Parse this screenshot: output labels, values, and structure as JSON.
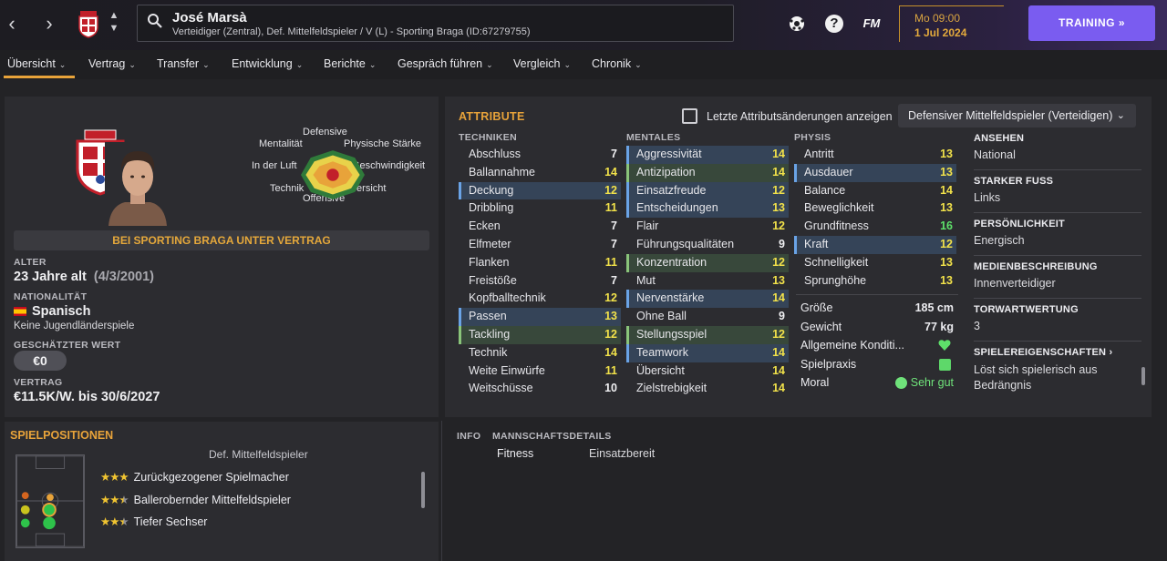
{
  "header": {
    "player_name": "José Marsà",
    "player_subtitle": "Verteidiger (Zentral), Def. Mittelfeldspieler / V (L) - Sporting Braga (ID:67279755)",
    "date_time": "Mo 09:00",
    "date_day": "1 Jul 2024",
    "training_label": "TRAINING »",
    "fm_label": "FM",
    "help_label": "?"
  },
  "tabs": [
    {
      "label": "Übersicht"
    },
    {
      "label": "Vertrag"
    },
    {
      "label": "Transfer"
    },
    {
      "label": "Entwicklung"
    },
    {
      "label": "Berichte"
    },
    {
      "label": "Gespräch führen"
    },
    {
      "label": "Vergleich"
    },
    {
      "label": "Chronik"
    }
  ],
  "profile": {
    "radar_labels": {
      "top": "Defensive",
      "top_left": "Mentalität",
      "top_right": "Physische Stärke",
      "left": "In der Luft",
      "right": "Geschwindigkeit",
      "bottom_left": "Technik",
      "bottom_right": "Übersicht",
      "bottom": "Offensive"
    },
    "contract_banner": "BEI SPORTING BRAGA UNTER VERTRAG",
    "age_label": "ALTER",
    "age_value": "23 Jahre alt",
    "age_dob": "(4/3/2001)",
    "nationality_label": "NATIONALITÄT",
    "nationality_value": "Spanisch",
    "nationality_note": "Keine Jugendländerspiele",
    "value_label": "GESCHÄTZTER WERT",
    "value_amount": "€0",
    "contract_label": "VERTRAG",
    "contract_value": "€11.5K/W. bis 30/6/2027"
  },
  "attributes": {
    "title": "ATTRIBUTE",
    "checkbox_label": "Letzte Attributsänderungen anzeigen",
    "role_select": "Defensiver Mittelfeldspieler (Verteidigen)",
    "technik_head": "TECHNIKEN",
    "mental_head": "MENTALES",
    "physis_head": "PHYSIS",
    "technik": [
      {
        "name": "Abschluss",
        "value": "7"
      },
      {
        "name": "Ballannahme",
        "value": "14"
      },
      {
        "name": "Deckung",
        "value": "12"
      },
      {
        "name": "Dribbling",
        "value": "11"
      },
      {
        "name": "Ecken",
        "value": "7"
      },
      {
        "name": "Elfmeter",
        "value": "7"
      },
      {
        "name": "Flanken",
        "value": "11"
      },
      {
        "name": "Freistöße",
        "value": "7"
      },
      {
        "name": "Kopfballtechnik",
        "value": "12"
      },
      {
        "name": "Passen",
        "value": "13"
      },
      {
        "name": "Tackling",
        "value": "12"
      },
      {
        "name": "Technik",
        "value": "14"
      },
      {
        "name": "Weite Einwürfe",
        "value": "11"
      },
      {
        "name": "Weitschüsse",
        "value": "10"
      }
    ],
    "mental": [
      {
        "name": "Aggressivität",
        "value": "14"
      },
      {
        "name": "Antizipation",
        "value": "14"
      },
      {
        "name": "Einsatzfreude",
        "value": "12"
      },
      {
        "name": "Entscheidungen",
        "value": "13"
      },
      {
        "name": "Flair",
        "value": "12"
      },
      {
        "name": "Führungsqualitäten",
        "value": "9"
      },
      {
        "name": "Konzentration",
        "value": "12"
      },
      {
        "name": "Mut",
        "value": "13"
      },
      {
        "name": "Nervenstärke",
        "value": "14"
      },
      {
        "name": "Ohne Ball",
        "value": "9"
      },
      {
        "name": "Stellungsspiel",
        "value": "12"
      },
      {
        "name": "Teamwork",
        "value": "14"
      },
      {
        "name": "Übersicht",
        "value": "14"
      },
      {
        "name": "Zielstrebigkeit",
        "value": "14"
      }
    ],
    "physis": [
      {
        "name": "Antritt",
        "value": "13"
      },
      {
        "name": "Ausdauer",
        "value": "13"
      },
      {
        "name": "Balance",
        "value": "14"
      },
      {
        "name": "Beweglichkeit",
        "value": "13"
      },
      {
        "name": "Grundfitness",
        "value": "16"
      },
      {
        "name": "Kraft",
        "value": "12"
      },
      {
        "name": "Schnelligkeit",
        "value": "13"
      },
      {
        "name": "Sprunghöhe",
        "value": "13"
      }
    ],
    "physical_info": {
      "height_label": "Größe",
      "height_value": "185 cm",
      "weight_label": "Gewicht",
      "weight_value": "77 kg",
      "condition_label": "Allgemeine Konditi...",
      "practice_label": "Spielpraxis",
      "morale_label": "Moral",
      "morale_value": "Sehr gut"
    }
  },
  "info": {
    "reputation_head": "ANSEHEN",
    "reputation_value": "National",
    "foot_head": "STARKER FUSS",
    "foot_value": "Links",
    "personality_head": "PERSÖNLICHKEIT",
    "personality_value": "Energisch",
    "media_head": "MEDIENBESCHREIBUNG",
    "media_value": "Innenverteidiger",
    "gk_head": "TORWARTWERTUNG",
    "gk_value": "3",
    "traits_head": "SPIELEREIGENSCHAFTEN ›",
    "traits_value": "Löst sich spielerisch aus Bedrängnis"
  },
  "positions": {
    "title": "SPIELPOSITIONEN",
    "role_heading": "Def. Mittelfeldspieler",
    "roles": [
      {
        "name": "Zurückgezogener Spielmacher",
        "stars": 3
      },
      {
        "name": "Ballerobernder Mittelfeldspieler",
        "stars": 2.5
      },
      {
        "name": "Tiefer Sechser",
        "stars": 2.5
      }
    ]
  },
  "team_details": {
    "info_tab": "INFO",
    "details_tab": "MANNSCHAFTSDETAILS",
    "fitness_label": "Fitness",
    "fitness_value": "Einsatzbereit"
  },
  "colors": {
    "accent": "#e8a33a",
    "training_button": "#7a5cf0",
    "attr_yellow": "#f2e24a",
    "attr_green": "#5ee06a"
  }
}
